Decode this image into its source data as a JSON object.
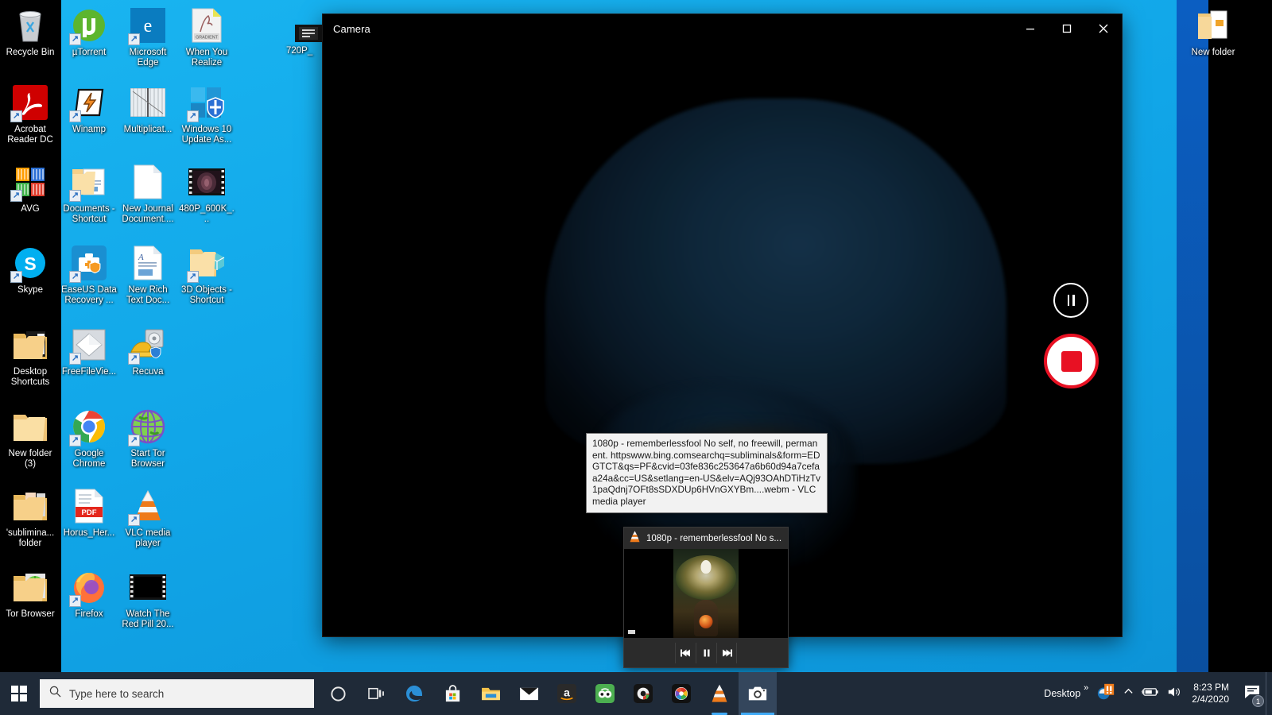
{
  "desktop": {
    "icons_col0": [
      {
        "label": "Recycle Bin",
        "icon": "recycle-bin-icon",
        "shortcut": false
      },
      {
        "label": "Acrobat Reader DC",
        "icon": "acrobat-reader-icon",
        "shortcut": true
      },
      {
        "label": "AVG",
        "icon": "avg-icon",
        "shortcut": true
      },
      {
        "label": "Skype",
        "icon": "skype-icon",
        "shortcut": true
      },
      {
        "label": "Desktop Shortcuts",
        "icon": "folder-icon",
        "shortcut": false
      },
      {
        "label": "New folder (3)",
        "icon": "folder-icon",
        "shortcut": false
      },
      {
        "label": "'sublimina... folder",
        "icon": "folder-icon",
        "shortcut": false
      },
      {
        "label": "Tor Browser",
        "icon": "folder-icon",
        "shortcut": false
      }
    ],
    "icons_col1": [
      {
        "label": "µTorrent",
        "icon": "utorrent-icon",
        "shortcut": true
      },
      {
        "label": "Winamp",
        "icon": "winamp-icon",
        "shortcut": true
      },
      {
        "label": "Documents - Shortcut",
        "icon": "documents-folder-icon",
        "shortcut": true
      },
      {
        "label": "EaseUS Data Recovery ...",
        "icon": "easeus-icon",
        "shortcut": true
      },
      {
        "label": "FreeFileVie...",
        "icon": "freefileviewer-icon",
        "shortcut": true
      },
      {
        "label": "Google Chrome",
        "icon": "chrome-icon",
        "shortcut": true
      },
      {
        "label": "Horus_Her...",
        "icon": "pdf-file-icon",
        "shortcut": false
      },
      {
        "label": "Firefox",
        "icon": "firefox-icon",
        "shortcut": true
      }
    ],
    "icons_col2": [
      {
        "label": "Microsoft Edge",
        "icon": "edge-icon",
        "shortcut": true
      },
      {
        "label": "Multiplicat...",
        "icon": "image-file-icon",
        "shortcut": false
      },
      {
        "label": "New Journal Document....",
        "icon": "blank-document-icon",
        "shortcut": false
      },
      {
        "label": "New Rich Text Doc...",
        "icon": "rich-text-document-icon",
        "shortcut": false
      },
      {
        "label": "Recuva",
        "icon": "recuva-icon",
        "shortcut": true
      },
      {
        "label": "Start Tor Browser",
        "icon": "tor-browser-icon",
        "shortcut": true
      },
      {
        "label": "VLC media player",
        "icon": "vlc-icon",
        "shortcut": true
      },
      {
        "label": "Watch The Red Pill 20...",
        "icon": "video-file-icon",
        "shortcut": false
      }
    ],
    "icons_col3": [
      {
        "label": "When You Realize",
        "icon": "gradient-file-icon",
        "shortcut": false
      },
      {
        "label": "Windows 10 Update As...",
        "icon": "windows-update-assistant-icon",
        "shortcut": true
      },
      {
        "label": "480P_600K_...",
        "icon": "video-file-icon",
        "shortcut": false
      },
      {
        "label": "3D Objects - Shortcut",
        "icon": "3d-objects-folder-icon",
        "shortcut": true
      }
    ],
    "icon_partial": {
      "label": "720P_",
      "icon": "video-file-icon"
    },
    "icon_right": {
      "label": "New folder",
      "icon": "open-folder-icon"
    }
  },
  "camera_window": {
    "title": "Camera",
    "minimize_label": "Minimize",
    "maximize_label": "Maximize",
    "close_label": "Close",
    "pause_button_label": "Pause",
    "record_button_label": "Stop recording",
    "accent_red": "#e81123"
  },
  "tooltip": {
    "text": "1080p - rememberlessfool No self, no freewill, permanent. httpswww.bing.comsearchq=subliminals&form=EDGTCT&qs=PF&cvid=03fe836c253647a6b60d94a7cefaa24a&cc=US&setlang=en-US&elv=AQj93OAhDTiHzTv1paQdnj7OFt8sSDXDUp6HVnGXYBm....webm - VLC media player"
  },
  "thumbnail_preview": {
    "title": "1080p - rememberlessfool No s...",
    "app_icon": "vlc-icon",
    "prev_label": "Previous",
    "play_pause_label": "Pause",
    "next_label": "Next"
  },
  "taskbar": {
    "start_label": "Start",
    "search": {
      "placeholder": "Type here to search",
      "icon": "search-icon"
    },
    "items": [
      {
        "name": "cortana-icon",
        "label": "Cortana"
      },
      {
        "name": "task-view-icon",
        "label": "Task View"
      },
      {
        "name": "edge-icon",
        "label": "Microsoft Edge"
      },
      {
        "name": "microsoft-store-icon",
        "label": "Microsoft Store"
      },
      {
        "name": "file-explorer-icon",
        "label": "File Explorer"
      },
      {
        "name": "mail-icon",
        "label": "Mail"
      },
      {
        "name": "amazon-icon",
        "label": "Amazon"
      },
      {
        "name": "tripadvisor-icon",
        "label": "TripAdvisor"
      },
      {
        "name": "cyberlink-icon",
        "label": "CyberLink"
      },
      {
        "name": "photo-director-icon",
        "label": "PhotoDirector"
      },
      {
        "name": "vlc-icon",
        "label": "VLC media player"
      },
      {
        "name": "camera-icon",
        "label": "Camera"
      }
    ],
    "tray": {
      "desktop_label": "Desktop",
      "overflow_icon": "chevron-double-right-icon",
      "avg_icon": "avg-tray-icon",
      "chevron_icon": "chevron-up-icon",
      "battery_icon": "battery-charging-icon",
      "volume_icon": "volume-icon",
      "time": "8:23 PM",
      "date": "2/4/2020",
      "action_center_icon": "action-center-icon",
      "notification_count": "1"
    }
  },
  "colors": {
    "desktop_blue": "#17b2ee",
    "taskbar": "#1f2a38",
    "accent": "#3fa9f5",
    "record_red": "#e81123"
  }
}
